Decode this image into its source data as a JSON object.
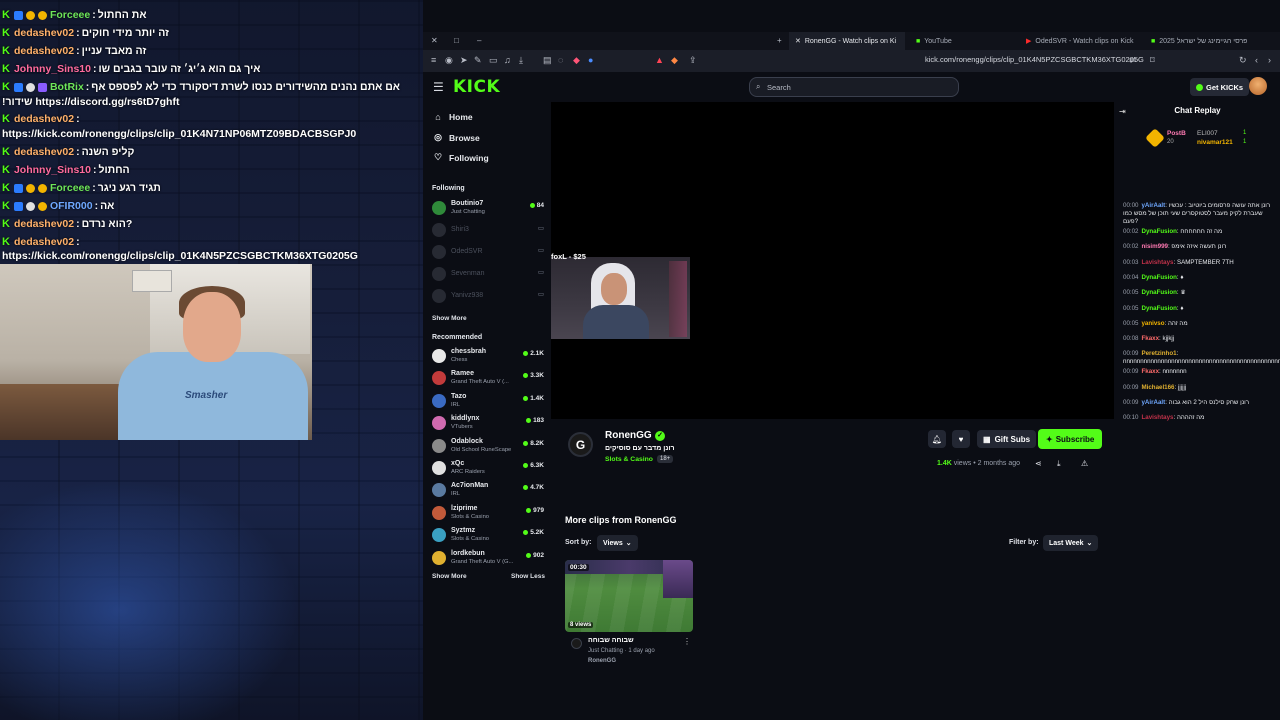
{
  "overlay_chat": [
    {
      "user": "Forceee",
      "msg": "את החתול",
      "color": "green"
    },
    {
      "user": "dedashev02",
      "msg": "זה יותר מידי חוקים",
      "color": "orange"
    },
    {
      "user": "dedashev02",
      "msg": "זה מאבד עניין",
      "color": "orange"
    },
    {
      "user": "Johnny_Sins10",
      "msg": "איך גם הוא ג׳יג׳ זה עובר בגבים שו",
      "color": "pink"
    },
    {
      "user": "BotRix",
      "msg": "אם אתם נהנים מהשידורים כנסו לשרת דיסקורד כדי לא לפספס אף",
      "color": "green"
    },
    {
      "user": "",
      "msg": "!שידור https://discord.gg/rs6tD7ghft",
      "color": "none"
    },
    {
      "user": "dedashev02",
      "msg": ":",
      "color": "orange"
    },
    {
      "user": "",
      "msg": "https://kick.com/ronengg/clips/clip_01K4N71NP06MTZ09BDACBSGPJ0",
      "color": "none"
    },
    {
      "user": "dedashev02",
      "msg": "קליפ השנה",
      "color": "orange"
    },
    {
      "user": "Johnny_Sins10",
      "msg": "החתול",
      "color": "pink"
    },
    {
      "user": "Forceee",
      "msg": "תגיד רגע ניגר",
      "color": "green"
    },
    {
      "user": "OFIR000",
      "msg": "אה",
      "color": "blue"
    },
    {
      "user": "dedashev02",
      "msg": "הוא נרדם?",
      "color": "orange"
    },
    {
      "user": "dedashev02",
      "msg": ":",
      "color": "orange"
    },
    {
      "user": "",
      "msg": "https://kick.com/ronengg/clips/clip_01K4N5PZCSGBCTKM36XTG0205G",
      "color": "none"
    }
  ],
  "webcam": {
    "shirt_text": "Smasher"
  },
  "browser": {
    "tabs": [
      {
        "label": "RonenGG - Watch clips on Ki",
        "active": true
      },
      {
        "label": "YouTube",
        "active": false
      },
      {
        "label": "OdedSVR - Watch clips on Kick",
        "active": false
      },
      {
        "label": "פרסי הגיימינג של ישראל 2025",
        "active": false
      }
    ],
    "url": "kick.com/ronengg/clips/clip_01K4N5PZCSGBCTKM36XTG0205G"
  },
  "header": {
    "logo": "KICK",
    "search_placeholder": "Search",
    "get_kicks": "Get KICKs"
  },
  "sidebar": {
    "nav": [
      {
        "label": "Home",
        "icon": "home-icon"
      },
      {
        "label": "Browse",
        "icon": "compass-icon"
      },
      {
        "label": "Following",
        "icon": "heart-icon"
      }
    ],
    "following_title": "Following",
    "following": [
      {
        "name": "Boutinio7",
        "sub": "Just Chatting",
        "viewers": "84",
        "online": true,
        "color": "#2f8a3a"
      },
      {
        "name": "Shiri3",
        "sub": "",
        "viewers": "",
        "online": false,
        "color": "#444"
      },
      {
        "name": "OdedSVR",
        "sub": "",
        "viewers": "",
        "online": false,
        "color": "#444"
      },
      {
        "name": "Sevenman",
        "sub": "",
        "viewers": "",
        "online": false,
        "color": "#444"
      },
      {
        "name": "Yanivz938",
        "sub": "",
        "viewers": "",
        "online": false,
        "color": "#444"
      }
    ],
    "show_more": "Show More",
    "recommended_title": "Recommended",
    "recommended": [
      {
        "name": "chessbrah",
        "sub": "Chess",
        "viewers": "2.1K",
        "color": "#e8e8e8"
      },
      {
        "name": "Ramee",
        "sub": "Grand Theft Auto V (...",
        "viewers": "3.3K",
        "color": "#c23b3b"
      },
      {
        "name": "Tazo",
        "sub": "IRL",
        "viewers": "1.4K",
        "color": "#3a6ac2"
      },
      {
        "name": "kiddlynx",
        "sub": "VTubers",
        "viewers": "183",
        "color": "#d06ab0"
      },
      {
        "name": "Odablock",
        "sub": "Old School RuneScape",
        "viewers": "8.2K",
        "color": "#8a8a8a"
      },
      {
        "name": "xQc",
        "sub": "ARC Raiders",
        "viewers": "6.3K",
        "color": "#e0e0e0"
      },
      {
        "name": "Ac7ionMan",
        "sub": "IRL",
        "viewers": "4.7K",
        "color": "#5a7aa0"
      },
      {
        "name": "lziprime",
        "sub": "Slots & Casino",
        "viewers": "979",
        "color": "#c25a3a"
      },
      {
        "name": "Syztmz",
        "sub": "Slots & Casino",
        "viewers": "5.2K",
        "color": "#3aa0c2"
      },
      {
        "name": "lordkebun",
        "sub": "Grand Theft Auto V (G...",
        "viewers": "902",
        "color": "#e0b030"
      }
    ],
    "show_more_2": "Show More",
    "show_less": "Show Less"
  },
  "player": {
    "donation": "foxL - $25"
  },
  "channel": {
    "name": "RonenGG",
    "clip_title": "רונן מדבר עם סוסיקים",
    "category": "Slots & Casino",
    "age": "18+",
    "gift_subs": "Gift Subs",
    "subscribe": "Subscribe",
    "views_count": "1.4K",
    "views_label": "views",
    "posted": "• 2 months ago"
  },
  "more_clips": {
    "title": "More clips from RonenGG",
    "sort_label": "Sort by:",
    "sort_value": "Views",
    "filter_label": "Filter by:",
    "filter_value": "Last Week",
    "clips": [
      {
        "duration": "00:30",
        "views": "8 views",
        "title": "שבוחה שבוחה",
        "meta": "Just Chatting · 1 day ago",
        "channel": "RonenGG"
      }
    ]
  },
  "chat_replay": {
    "title": "Chat Replay",
    "pinned": {
      "user1": "PostB",
      "sub1": "20",
      "user2": "ELI007",
      "user3": "nivamar121",
      "count1": "1",
      "count2": "1"
    },
    "messages": [
      {
        "time": "00:00",
        "user": "yAirAalt",
        "color": "#6fa8ff",
        "msg": "רונן אתה עושה פרסומים ביוטיוב : עכשיו שעברת לקיק מעבר לסטוקסרים שעי תוכן של מסש כמו פעם?"
      },
      {
        "time": "00:02",
        "user": "DynaFusion",
        "color": "#53fc18",
        "msg": "מה זה חחחחחח"
      },
      {
        "time": "00:02",
        "user": "nisim999",
        "color": "#ff7ab3",
        "msg": "רונן תעשה איזה אימפ"
      },
      {
        "time": "00:03",
        "user": "Lavishtays",
        "color": "#c2324a",
        "msg": "SAMPTEMBER 7TH"
      },
      {
        "time": "00:04",
        "user": "DynaFusion",
        "color": "#53fc18",
        "msg": "♦"
      },
      {
        "time": "00:05",
        "user": "DynaFusion",
        "color": "#53fc18",
        "msg": "♛"
      },
      {
        "time": "00:05",
        "user": "DynaFusion",
        "color": "#53fc18",
        "msg": "♦"
      },
      {
        "time": "00:05",
        "user": "yanivso",
        "color": "#f2b400",
        "msg": "מה זהה"
      },
      {
        "time": "00:08",
        "user": "Fkaxx",
        "color": "#ff6b6b",
        "msg": "kjjkjj"
      },
      {
        "time": "00:09",
        "user": "Peretzinho1",
        "color": "#e0b030",
        "msg": "nnnnnnnnnnnnnnnnnnnnnnnnnnnnnnnnnnnnnnnnnnnnnnnnnnnnnnnnnnnn"
      },
      {
        "time": "00:09",
        "user": "Fkaxx",
        "color": "#ff6b6b",
        "msg": "nnnnnnn"
      },
      {
        "time": "00:09",
        "user": "Michael166",
        "color": "#e0b030",
        "msg": "jjjjjj"
      },
      {
        "time": "00:09",
        "user": "yAirAalt",
        "color": "#6fa8ff",
        "msg": "רונן שחק סילנס היל 2 הוא גבוה"
      },
      {
        "time": "00:10",
        "user": "Lavishtays",
        "color": "#c2324a",
        "msg": "מה זהההה"
      }
    ]
  }
}
